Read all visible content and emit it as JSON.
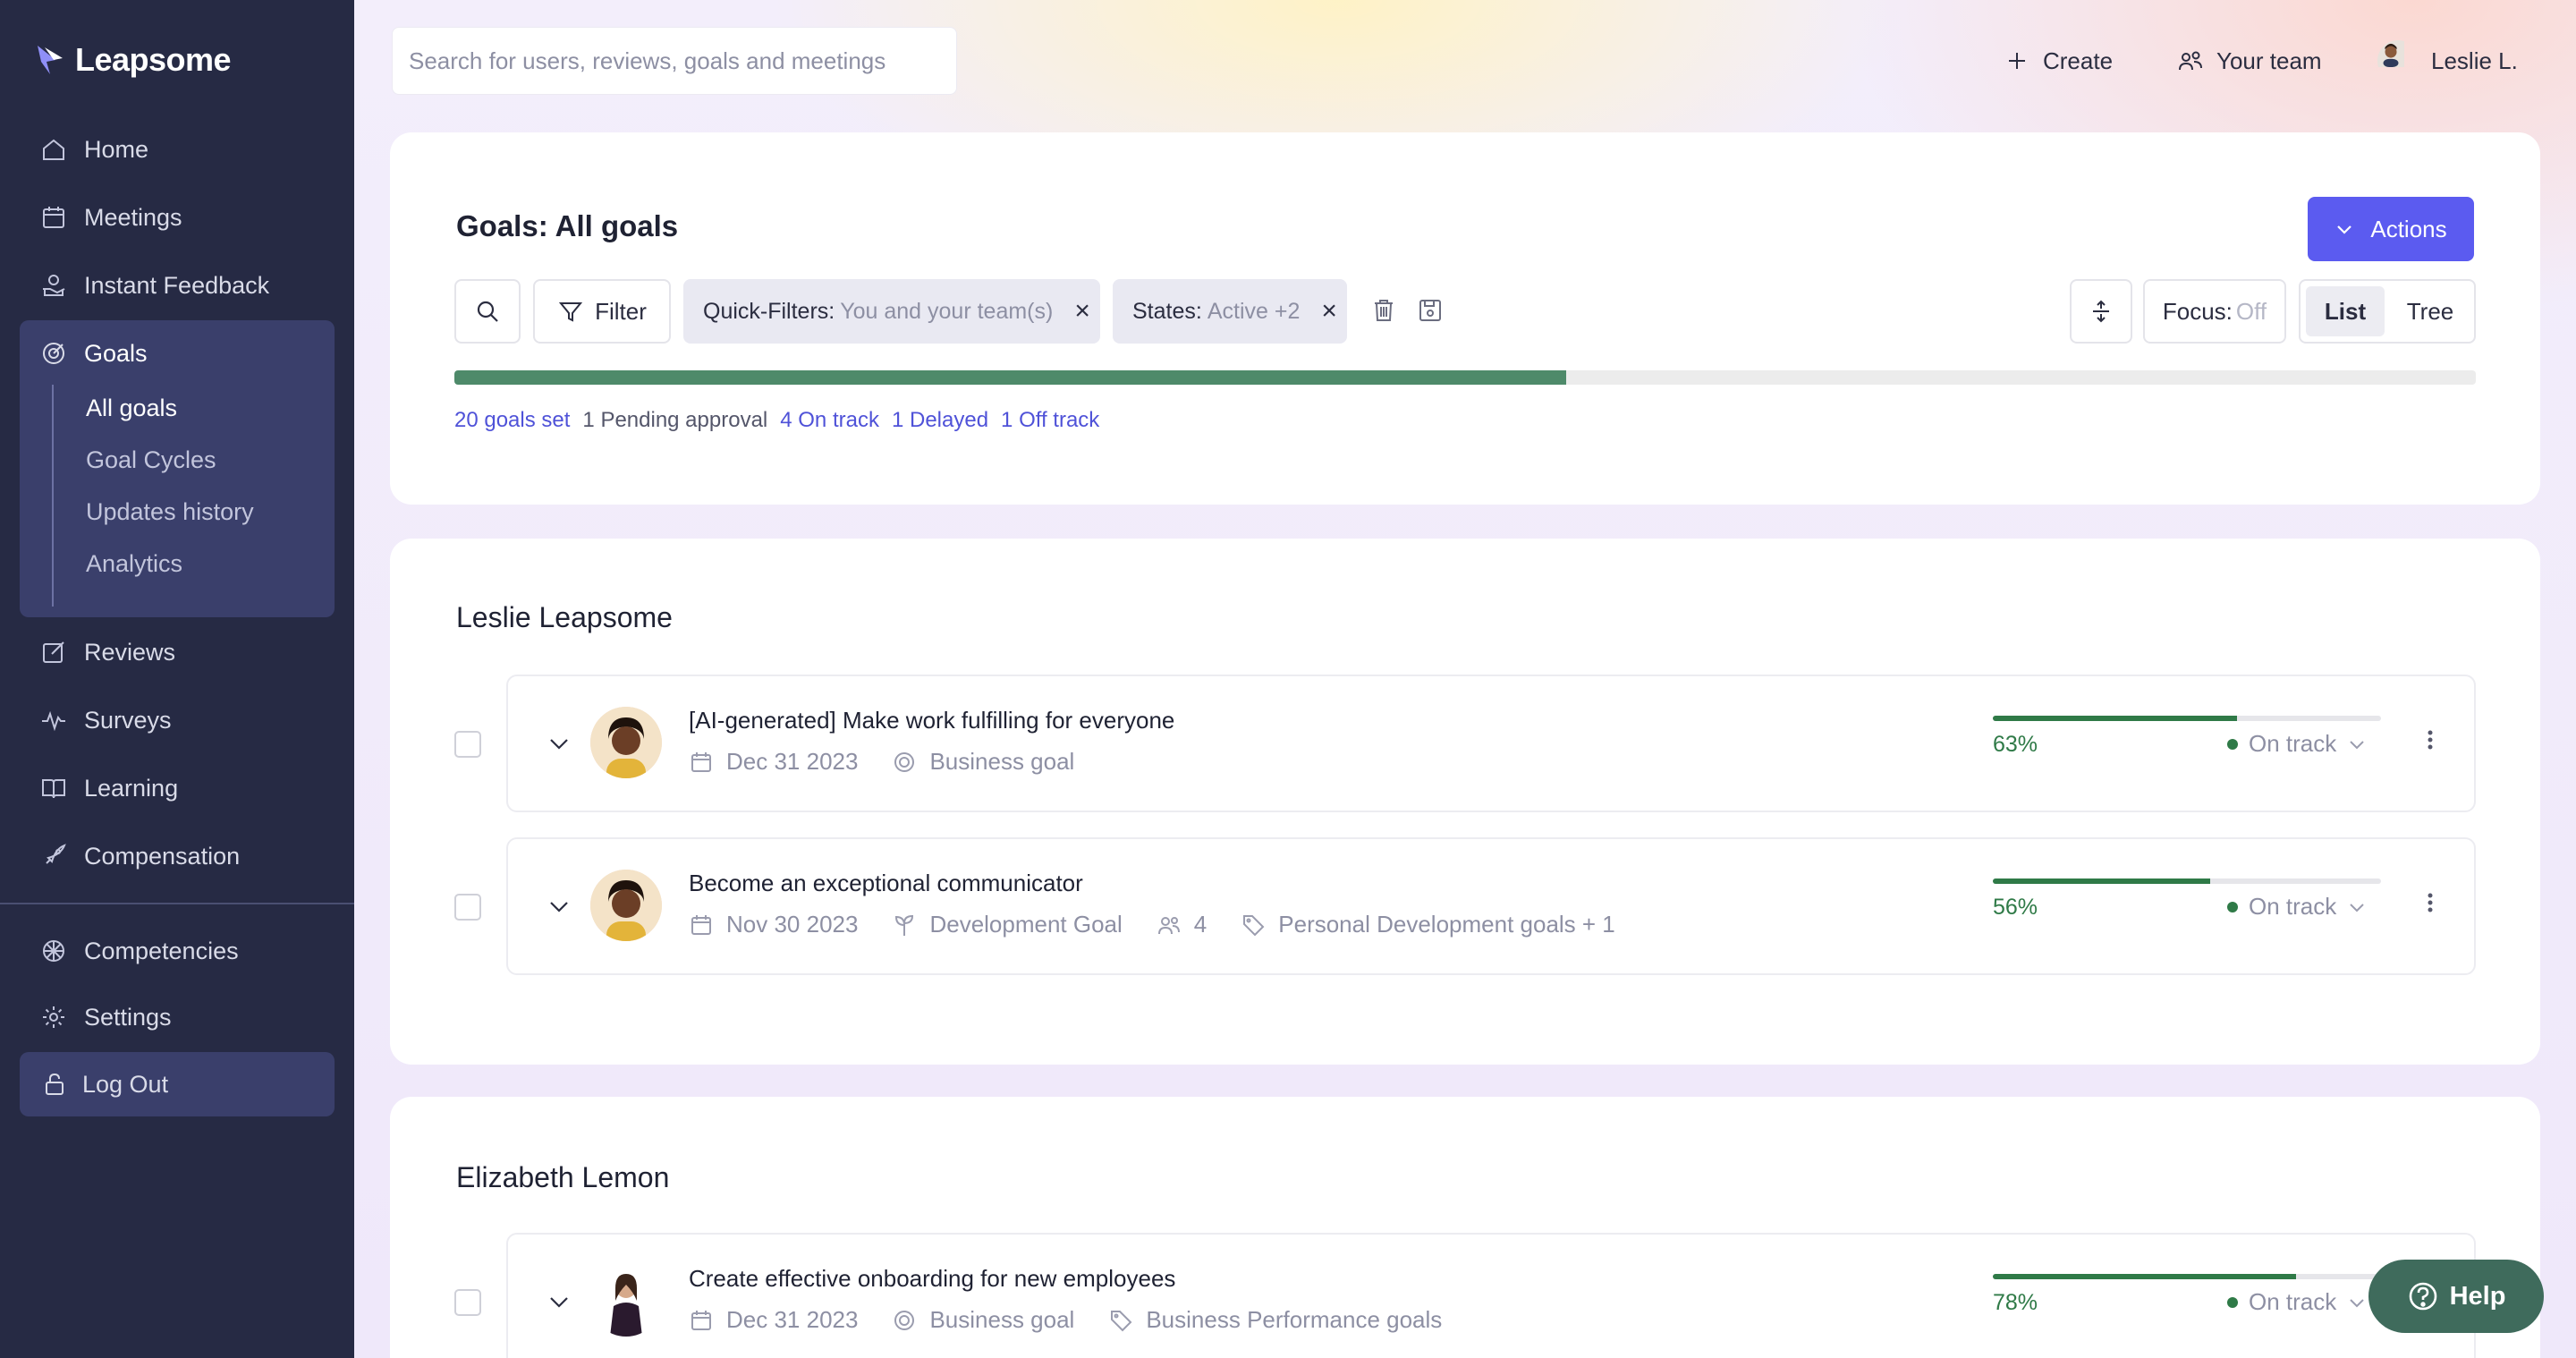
{
  "brand": {
    "name": "Leapsome"
  },
  "sidebar": {
    "items": [
      {
        "label": "Home",
        "icon": "home-icon"
      },
      {
        "label": "Meetings",
        "icon": "calendar-icon"
      },
      {
        "label": "Instant Feedback",
        "icon": "feedback-icon"
      },
      {
        "label": "Goals",
        "icon": "target-icon"
      },
      {
        "label": "Reviews",
        "icon": "edit-icon"
      },
      {
        "label": "Surveys",
        "icon": "pulse-icon"
      },
      {
        "label": "Learning",
        "icon": "book-icon"
      },
      {
        "label": "Compensation",
        "icon": "rocket-icon"
      },
      {
        "label": "Competencies",
        "icon": "competencies-icon"
      },
      {
        "label": "Settings",
        "icon": "gear-icon"
      }
    ],
    "goals_subnav": [
      "All goals",
      "Goal Cycles",
      "Updates history",
      "Analytics"
    ],
    "logout": "Log Out"
  },
  "topbar": {
    "search_placeholder": "Search for users, reviews, goals and meetings",
    "create": "Create",
    "your_team": "Your team",
    "user": "Leslie L."
  },
  "goals_header": {
    "title": "Goals: All goals",
    "actions": "Actions",
    "filter": "Filter",
    "quick_filters_label": "Quick-Filters:",
    "quick_filters_value": "You and your team(s)",
    "states_label": "States:",
    "states_value": "Active +2",
    "focus_label": "Focus:",
    "focus_value": "Off",
    "view_list": "List",
    "view_tree": "Tree",
    "progress_fraction": 0.55,
    "stats": {
      "set": "20 goals set",
      "pending": "1 Pending approval",
      "on_track": "4 On track",
      "delayed": "1 Delayed",
      "off_track": "1 Off track"
    }
  },
  "groups": [
    {
      "owner": "Leslie Leapsome",
      "goals": [
        {
          "title": "[AI-generated] Make work fulfilling for everyone",
          "date": "Dec 31 2023",
          "type": "Business goal",
          "progress": 63,
          "progress_label": "63%",
          "status": "On track"
        },
        {
          "title": "Become an exceptional communicator",
          "date": "Nov 30 2023",
          "type": "Development Goal",
          "participants": "4",
          "tags": "Personal Development goals + 1",
          "progress": 56,
          "progress_label": "56%",
          "status": "On track"
        }
      ]
    },
    {
      "owner": "Elizabeth Lemon",
      "goals": [
        {
          "title": "Create effective onboarding for new employees",
          "date": "Dec 31 2023",
          "type": "Business goal",
          "tags": "Business Performance goals",
          "progress": 78,
          "progress_label": "78%",
          "status": "On track"
        }
      ]
    }
  ],
  "help": "Help",
  "colors": {
    "sidebar": "#262a44",
    "accent": "#5b5bf0",
    "on_track": "#2f7a47",
    "help": "#3f6b5c"
  }
}
